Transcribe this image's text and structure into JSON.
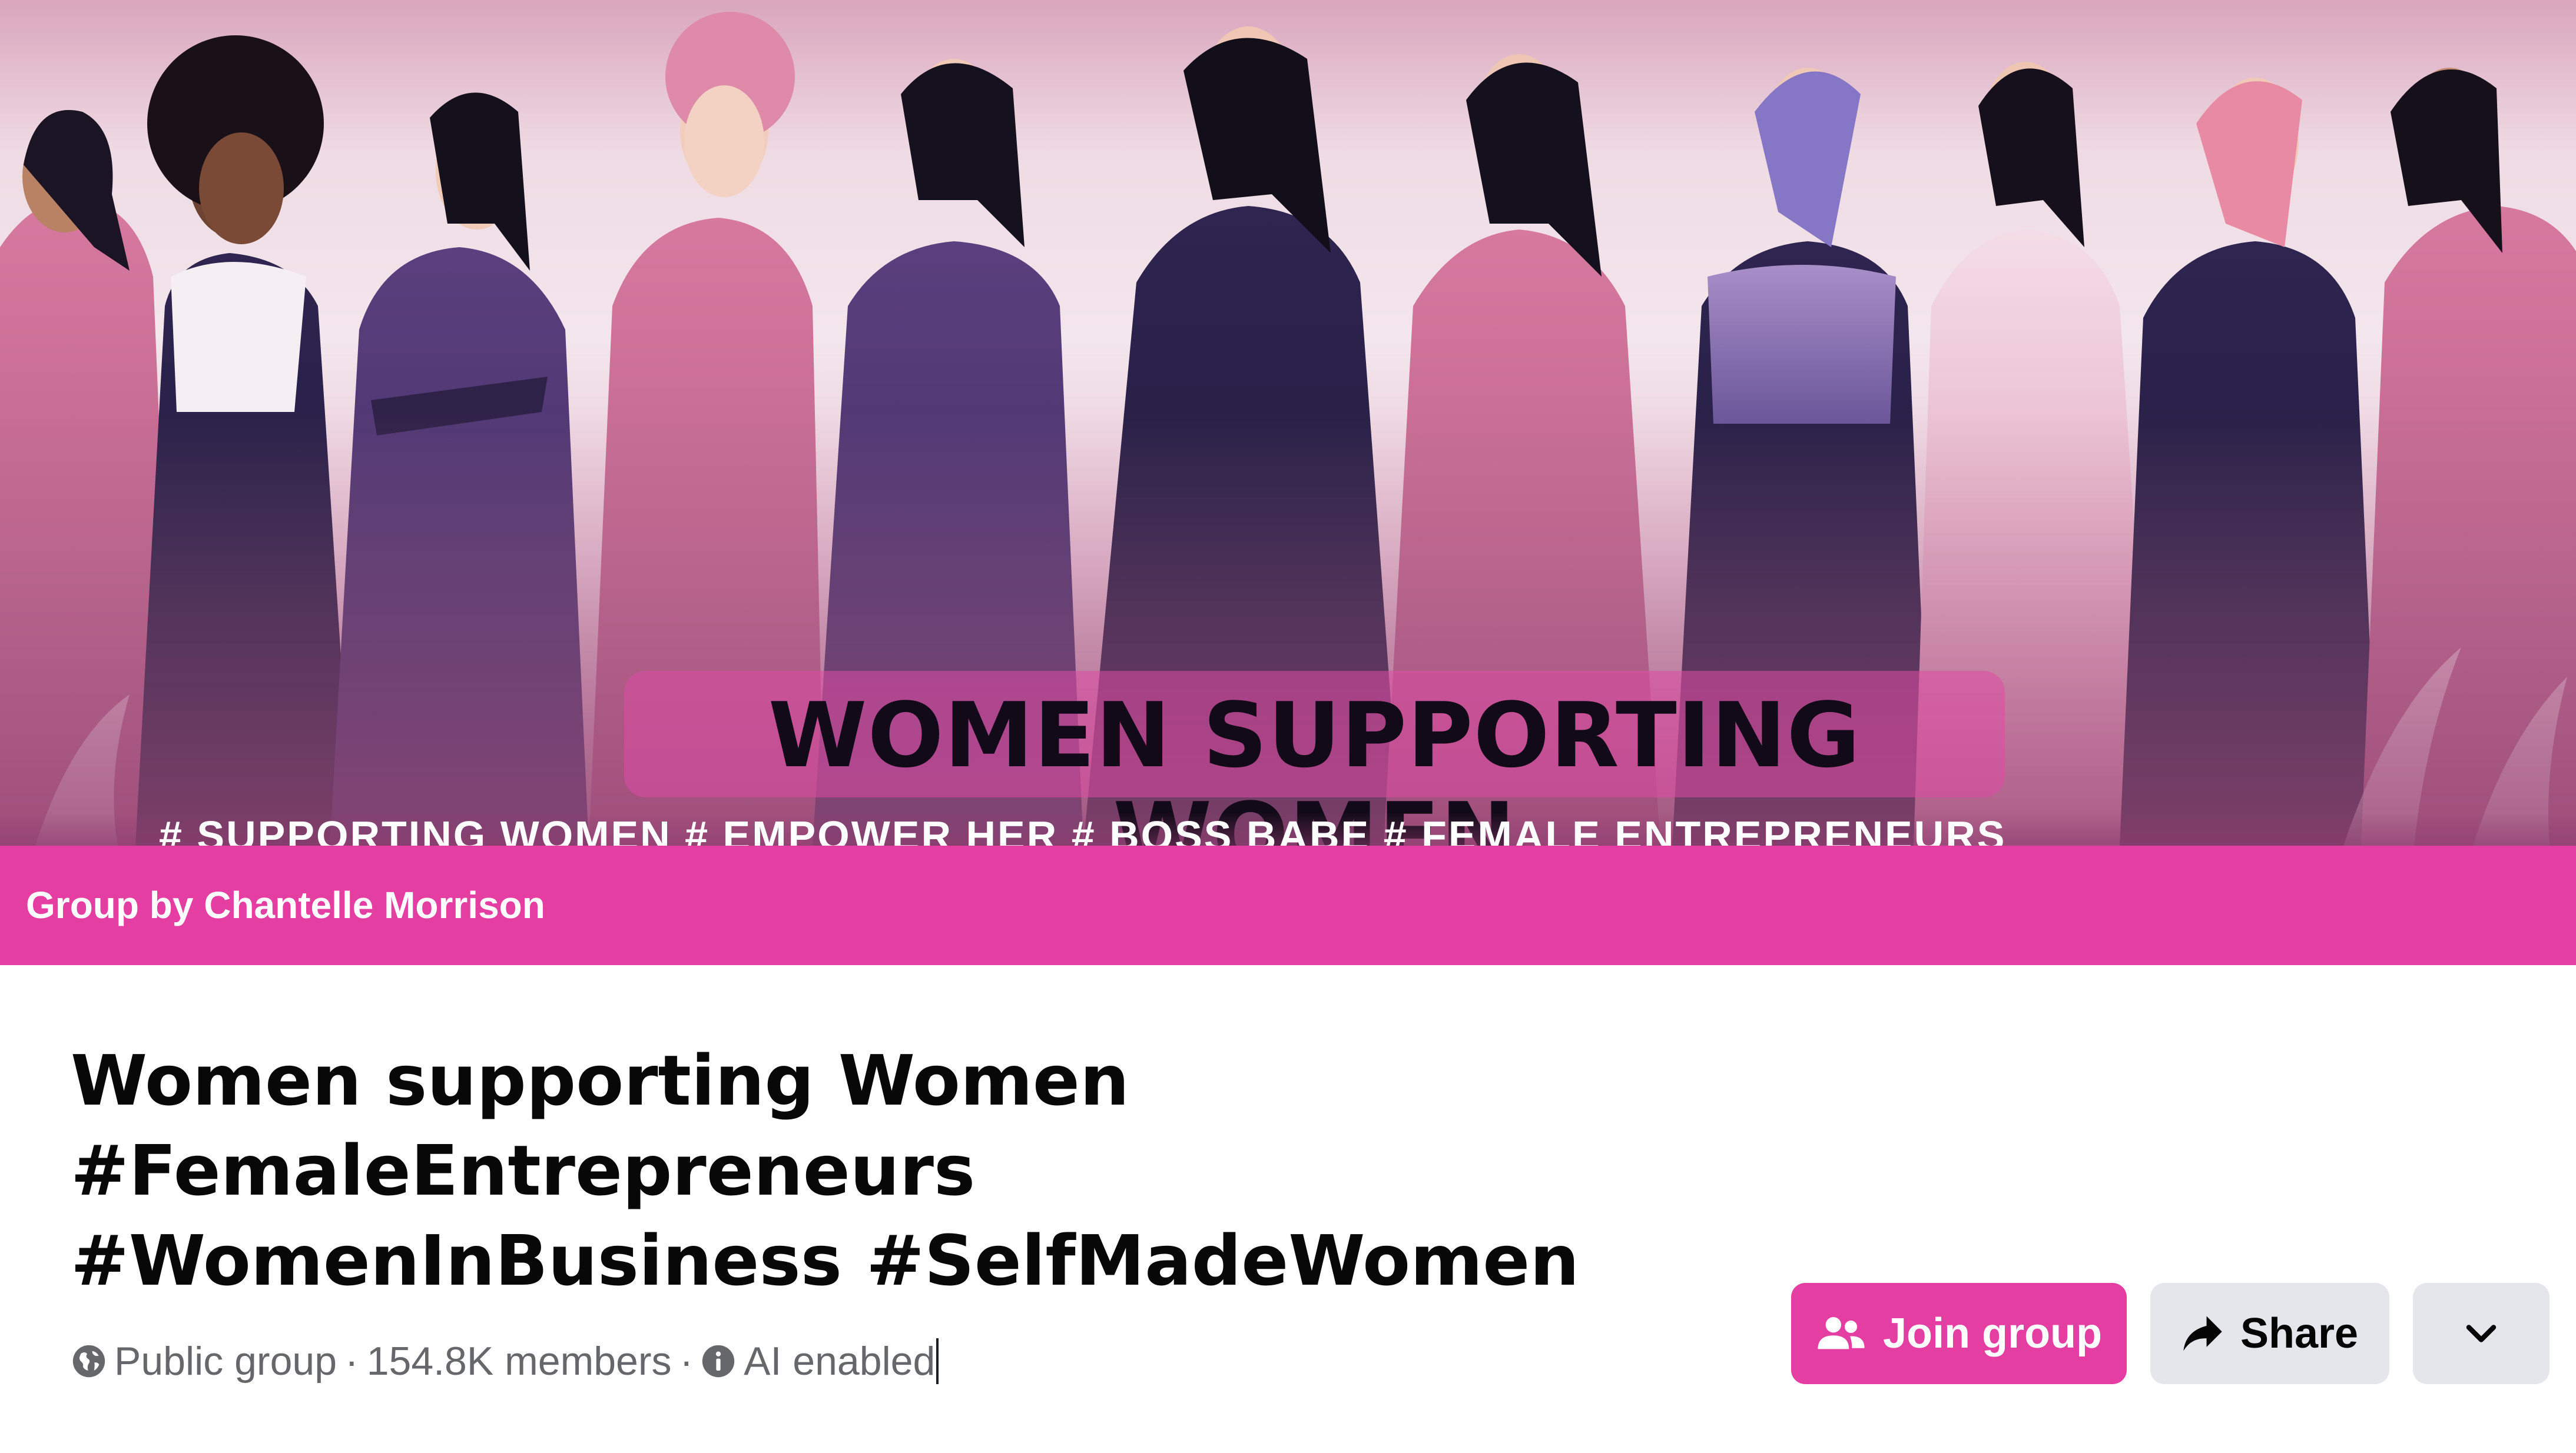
{
  "cover": {
    "headline": "WOMEN SUPPORTING WOMEN",
    "hashtag_strip": "# SUPPORTING WOMEN     # EMPOWER HER     # BOSS BABE     # FEMALE ENTREPRENEURS"
  },
  "owner_bar": {
    "text": "Group by Chantelle Morrison"
  },
  "group": {
    "title_lines": [
      "Women supporting Women",
      "#FemaleEntrepreneurs",
      "#WomenInBusiness #SelfMadeWomen"
    ],
    "privacy": "Public group",
    "members": "154.8K members",
    "separator": "·",
    "ai_status": "AI enabled"
  },
  "actions": {
    "join_label": "Join group",
    "share_label": "Share"
  },
  "icons": {
    "privacy": "globe-icon",
    "ai": "info-icon",
    "join": "people-icon",
    "share": "share-arrow-icon",
    "more": "chevron-down-icon"
  },
  "colors": {
    "brand_pink": "#e53ea3",
    "secondary_button": "#e4e6eb",
    "meta_text": "#65676b",
    "title_text": "#080809"
  }
}
